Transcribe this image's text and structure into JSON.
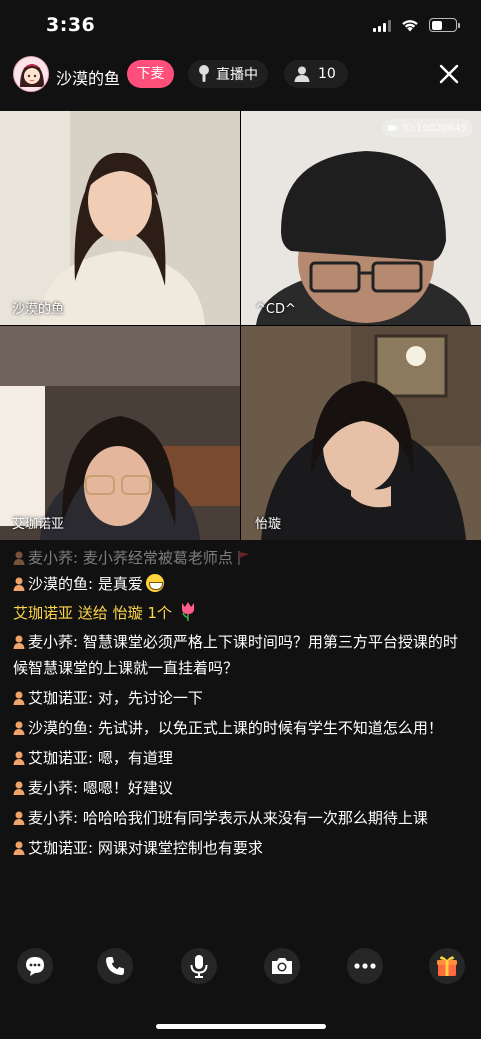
{
  "status_bar": {
    "time": "3:36"
  },
  "header": {
    "host_name": "沙漠的鱼",
    "leave_mic_label": "下麦",
    "live_label": "直播中",
    "viewer_count": "10"
  },
  "video_tiles": [
    {
      "name": "沙漠的鱼"
    },
    {
      "name": "^CD^",
      "id_label": "ID:10020645"
    },
    {
      "name": "艾珈诺亚"
    },
    {
      "name": "怡璇"
    }
  ],
  "chat": {
    "messages": [
      {
        "user": "麦小荞",
        "text": "麦小荞经常被葛老师点"
      },
      {
        "user": "沙漠的鱼",
        "text": "是真爱"
      },
      {
        "type": "gift",
        "sender": "艾珈诺亚",
        "verb": "送给",
        "receiver": "怡璇",
        "qty": "1个"
      },
      {
        "user": "麦小荞",
        "text": "智慧课堂必须严格上下课时间吗？用第三方平台授课的时候智慧课堂的上课就一直挂着吗？"
      },
      {
        "user": "艾珈诺亚",
        "text": "对，先讨论一下"
      },
      {
        "user": "沙漠的鱼",
        "text": "先试讲，以免正式上课的时候有学生不知道怎么用！"
      },
      {
        "user": "艾珈诺亚",
        "text": "嗯，有道理"
      },
      {
        "user": "麦小荞",
        "text": "嗯嗯！好建议"
      },
      {
        "user": "麦小荞",
        "text": "哈哈哈我们班有同学表示从来没有一次那么期待上课"
      },
      {
        "user": "艾珈诺亚",
        "text": "网课对课堂控制也有要求"
      }
    ]
  },
  "colors": {
    "accent": "#ff4f7a",
    "gift": "#ffd54a",
    "background": "#111111"
  },
  "toolbar": {
    "icons": [
      "chat-icon",
      "phone-icon",
      "microphone-icon",
      "camera-icon",
      "more-icon",
      "gift-icon"
    ]
  }
}
